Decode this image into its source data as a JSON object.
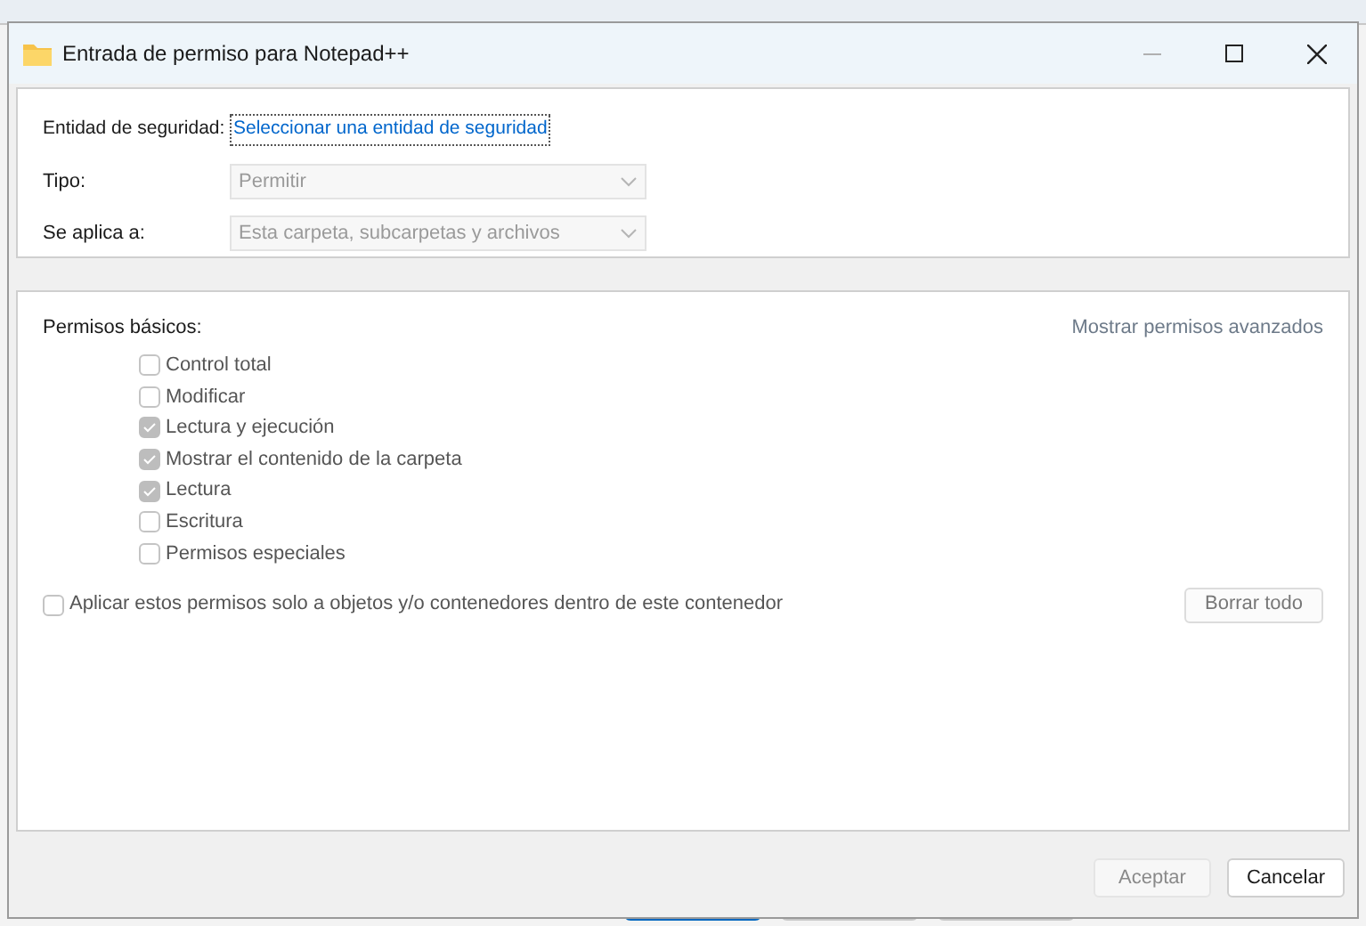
{
  "window": {
    "title": "Entrada de permiso para Notepad++"
  },
  "principal": {
    "label": "Entidad de seguridad:",
    "link": "Seleccionar una entidad de seguridad"
  },
  "fields": [
    {
      "label": "Tipo:",
      "value": "Permitir",
      "disabled": true
    },
    {
      "label": "Se aplica a:",
      "value": "Esta carpeta, subcarpetas y archivos",
      "disabled": true
    }
  ],
  "permissions": {
    "title": "Permisos básicos:",
    "advanced_link": "Mostrar permisos avanzados",
    "items": [
      {
        "label": "Control total",
        "checked": false
      },
      {
        "label": "Modificar",
        "checked": false
      },
      {
        "label": "Lectura y ejecución",
        "checked": true
      },
      {
        "label": "Mostrar el contenido de la carpeta",
        "checked": true
      },
      {
        "label": "Lectura",
        "checked": true
      },
      {
        "label": "Escritura",
        "checked": false
      },
      {
        "label": "Permisos especiales",
        "checked": false
      }
    ],
    "apply_only": {
      "label": "Aplicar estos permisos solo a objetos y/o contenedores dentro de este contenedor",
      "checked": false
    },
    "clear_button": "Borrar todo"
  },
  "buttons": [
    {
      "label": "Aceptar",
      "disabled": true
    },
    {
      "label": "Cancelar",
      "disabled": false
    }
  ]
}
